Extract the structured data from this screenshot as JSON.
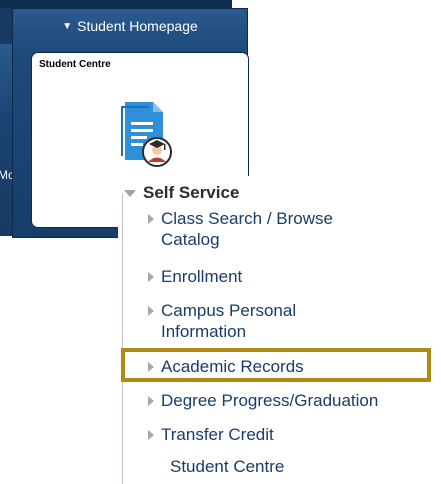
{
  "back_window": {
    "partial_text": "Mc"
  },
  "homepage": {
    "title": "Student Homepage",
    "tile": {
      "title": "Student Centre",
      "icon": "student-document-icon"
    }
  },
  "menu": {
    "header": "Self Service",
    "items": [
      {
        "label": "Class Search / Browse Catalog",
        "lines": [
          "Class Search / Browse",
          "Catalog"
        ]
      },
      {
        "label": "Enrollment",
        "lines": [
          "Enrollment"
        ]
      },
      {
        "label": "Campus Personal Information",
        "lines": [
          "Campus Personal",
          "Information"
        ]
      },
      {
        "label": "Academic Records",
        "lines": [
          "Academic Records"
        ],
        "highlighted": true
      },
      {
        "label": "Degree Progress/Graduation",
        "lines": [
          "Degree Progress/Graduation"
        ]
      },
      {
        "label": "Transfer Credit",
        "lines": [
          "Transfer Credit"
        ]
      },
      {
        "label": "Student Centre",
        "lines": [
          "Student Centre"
        ]
      }
    ]
  },
  "colors": {
    "panel_blue": "#173e69",
    "link_blue": "#1a3c6a",
    "highlight_gold": "#b08a10",
    "icon_blue": "#2f8fd8",
    "icon_red": "#c0392b"
  }
}
